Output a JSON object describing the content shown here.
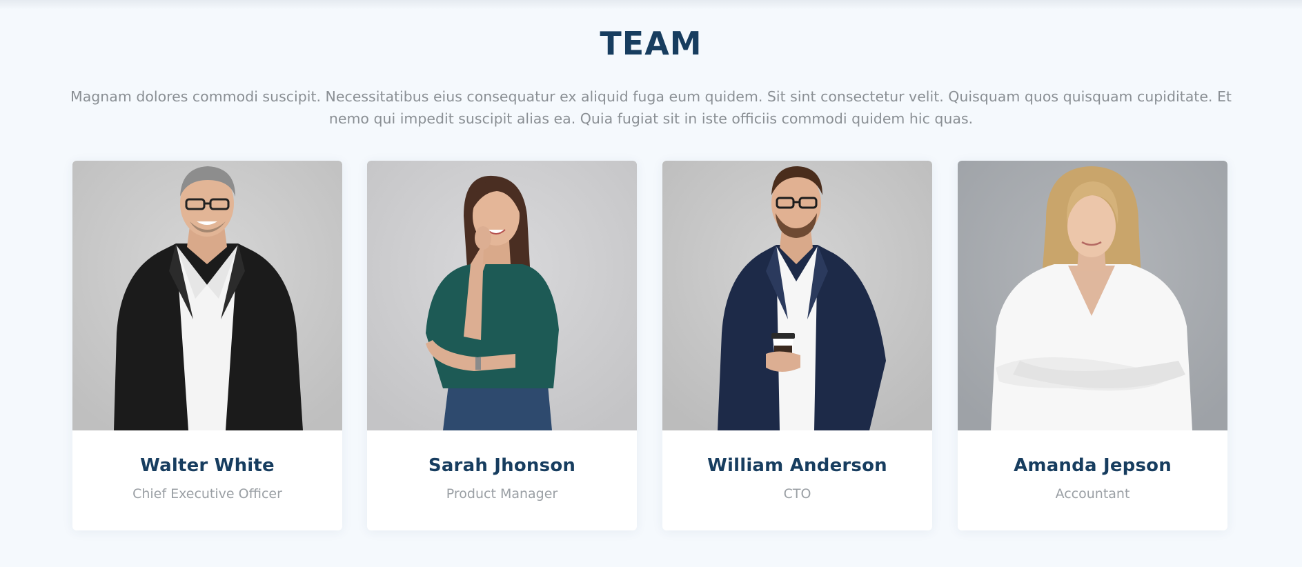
{
  "section": {
    "title": "TEAM",
    "description": "Magnam dolores commodi suscipit. Necessitatibus eius consequatur ex aliquid fuga eum quidem. Sit sint consectetur velit. Quisquam quos quisquam cupiditate. Et nemo qui impedit suscipit alias ea. Quia fugiat sit in iste officiis commodi quidem hic quas."
  },
  "colors": {
    "title": "#173d5f",
    "text_muted": "#8a8f94",
    "page_bg": "#f5f9fd",
    "card_bg": "#ffffff"
  },
  "team": [
    {
      "name": "Walter White",
      "role": "Chief Executive Officer",
      "photo_icon": "portrait-man-black-blazer"
    },
    {
      "name": "Sarah Jhonson",
      "role": "Product Manager",
      "photo_icon": "portrait-woman-green-shirt"
    },
    {
      "name": "William Anderson",
      "role": "CTO",
      "photo_icon": "portrait-man-navy-blazer-coffee"
    },
    {
      "name": "Amanda Jepson",
      "role": "Accountant",
      "photo_icon": "portrait-woman-white-blouse"
    }
  ]
}
